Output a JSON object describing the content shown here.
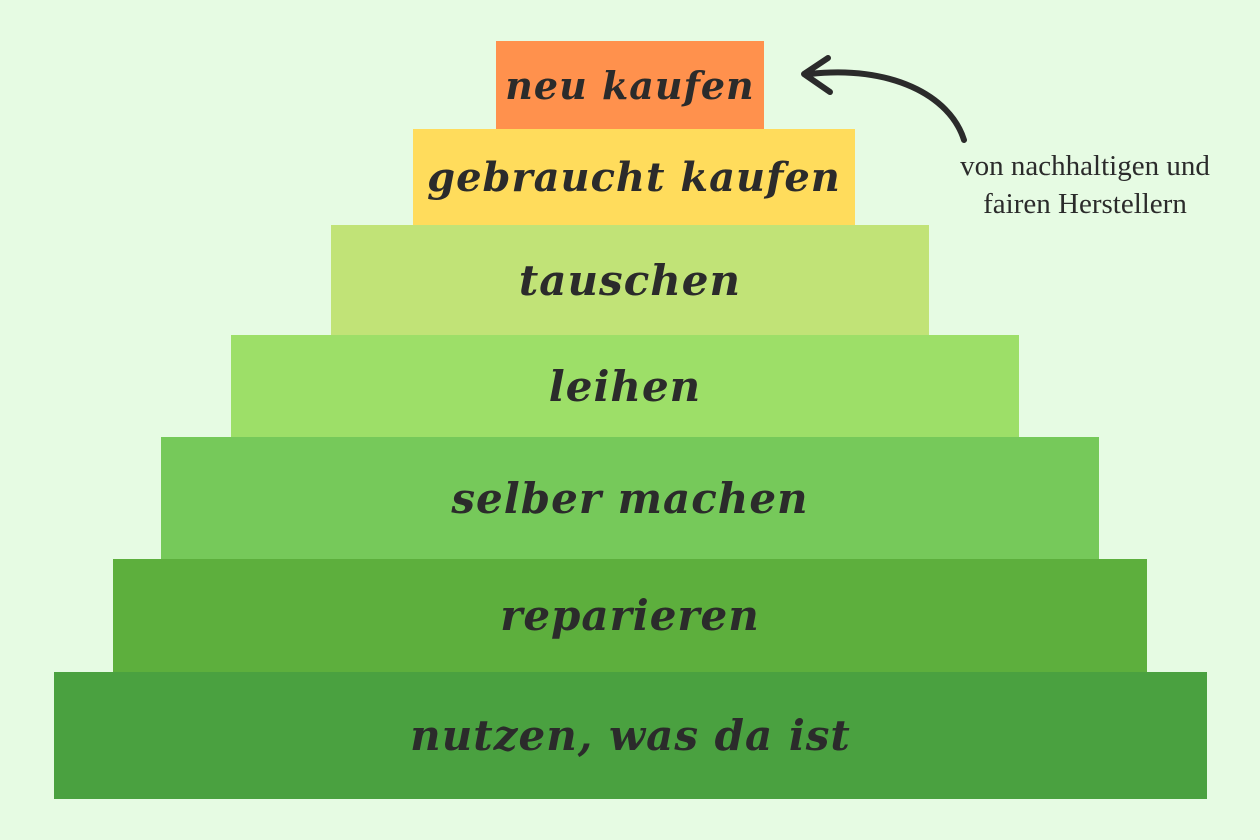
{
  "pyramid": {
    "tiers": [
      {
        "label": "neu kaufen",
        "color": "#ff914d"
      },
      {
        "label": "gebraucht kaufen",
        "color": "#ffdc5c"
      },
      {
        "label": "tauschen",
        "color": "#c1e377"
      },
      {
        "label": "leihen",
        "color": "#9ddf68"
      },
      {
        "label": "selber machen",
        "color": "#76c95a"
      },
      {
        "label": "reparieren",
        "color": "#5daf3d"
      },
      {
        "label": "nutzen, was da ist",
        "color": "#4aa140"
      }
    ]
  },
  "annotation": {
    "line1": "von nachhaltigen und",
    "line2": "fairen Herstellern"
  },
  "arrow": {
    "icon": "curved-arrow-icon",
    "points_to": "neu kaufen"
  },
  "colors": {
    "background": "#e6fbe3",
    "text": "#2b2b2b"
  }
}
